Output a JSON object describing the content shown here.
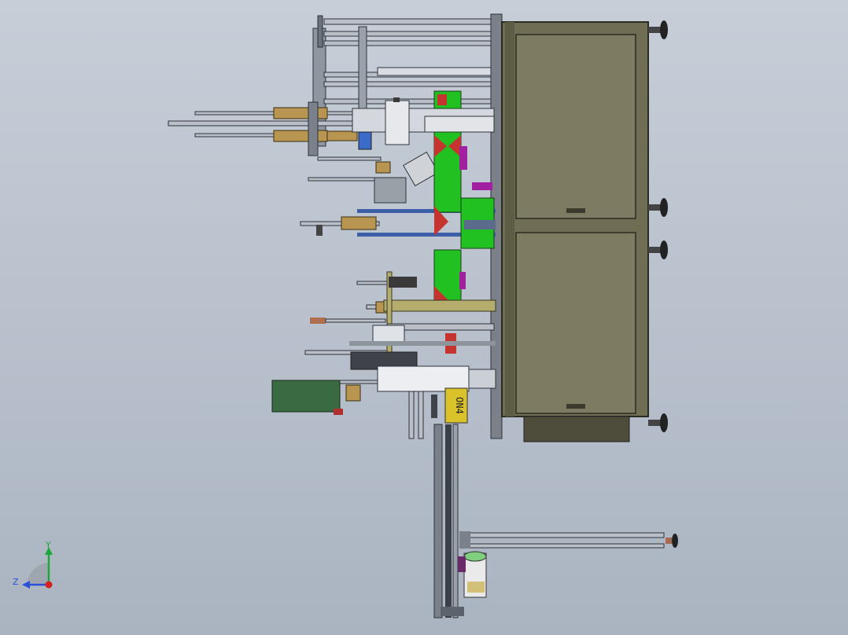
{
  "view": {
    "background_top": "#c7ced8",
    "background_bottom": "#aab4c1"
  },
  "cabinet": {
    "frame_color": "#6f6e54",
    "panel_color": "#7d7b61",
    "edge_color": "#2b2b22"
  },
  "colors": {
    "rail": "#b9bec7",
    "rail_dark": "#58606b",
    "brass": "#b89550",
    "fixture_green": "#22c122",
    "fixture_red": "#c5342e",
    "magenta": "#a020a0",
    "blue_bar": "#3d5fa8",
    "olive_plate": "#b5ad6e",
    "motor_green": "#3a6a42",
    "yellow_tag": "#d9c22a"
  },
  "tag": {
    "text": "ON4"
  },
  "triad": {
    "y_label": "Y",
    "z_label": "Z",
    "y_color": "#1fa83a",
    "z_color": "#2a50d8",
    "x_color": "#d42020"
  }
}
